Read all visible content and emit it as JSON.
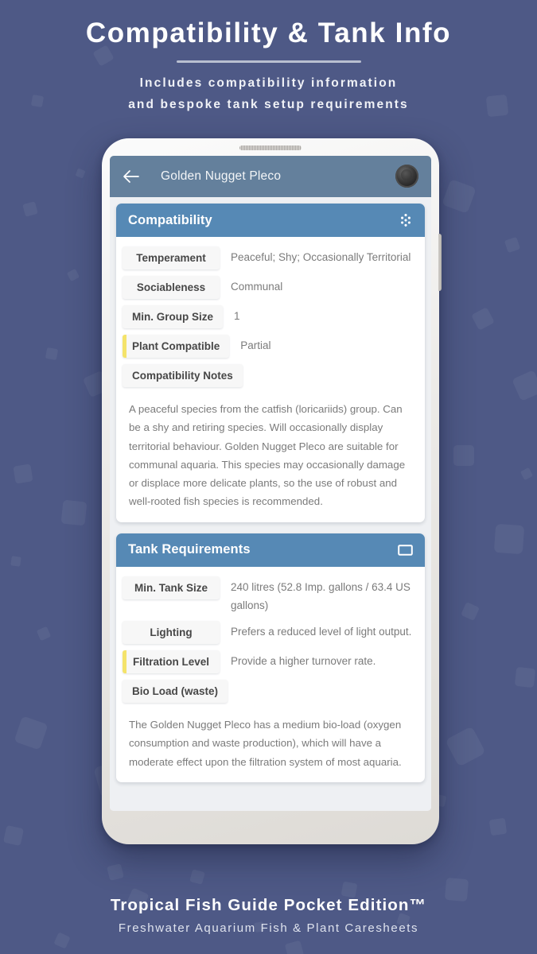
{
  "promo": {
    "title": "Compatibility & Tank Info",
    "subtitle_line1": "Includes compatibility information",
    "subtitle_line2": "and bespoke tank setup requirements",
    "footer_title": "Tropical Fish Guide Pocket Edition™",
    "footer_subtitle": "Freshwater Aquarium Fish & Plant Caresheets"
  },
  "colors": {
    "background": "#4e5986",
    "appbar": "#64809c",
    "card_header": "#5689b5",
    "accent_yellow": "#f4e36b",
    "chip_bg": "#f7f7f7",
    "value_text": "#7b7b7b"
  },
  "appbar": {
    "back_icon": "back-arrow-icon",
    "title": "Golden Nugget Pleco",
    "camera_icon": "camera-punch-hole-icon"
  },
  "cards": [
    {
      "title": "Compatibility",
      "icon": "dot-cluster-icon",
      "rows": [
        {
          "label": "Temperament",
          "value": "Peaceful; Shy; Occasionally Territorial",
          "accent": false
        },
        {
          "label": "Sociableness",
          "value": "Communal",
          "accent": false
        },
        {
          "label": "Min. Group Size",
          "value": "1",
          "accent": false
        },
        {
          "label": "Plant Compatible",
          "value": "Partial",
          "accent": true
        }
      ],
      "notes_label": "Compatibility Notes",
      "notes": "A peaceful species from the catfish (loricariids) group. Can be a shy and retiring species. Will occasionally display territorial behaviour. Golden Nugget Pleco are suitable for communal aquaria. This species may occasionally damage or displace more delicate plants, so the use of robust and well-rooted fish species is recommended."
    },
    {
      "title": "Tank Requirements",
      "icon": "tank-rectangle-icon",
      "rows": [
        {
          "label": "Min. Tank Size",
          "value": "240 litres  (52.8 Imp. gallons / 63.4 US gallons)",
          "accent": false
        },
        {
          "label": "Lighting",
          "value": "Prefers a reduced level of light output.",
          "accent": false
        },
        {
          "label": "Filtration Level",
          "value": "Provide a higher turnover rate.",
          "accent": true
        }
      ],
      "notes_label": "Bio Load (waste)",
      "notes": "The Golden Nugget Pleco has a medium bio-load (oxygen consumption and waste production), which will have a moderate effect upon the filtration system of most aquaria."
    }
  ]
}
